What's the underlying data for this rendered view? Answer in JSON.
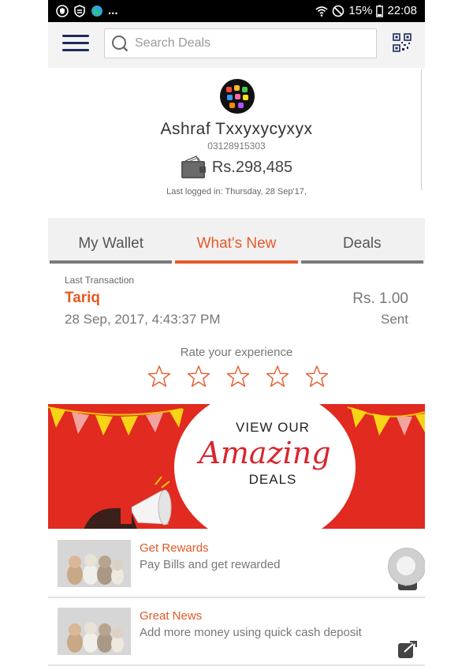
{
  "status_bar": {
    "left_extra": "...",
    "battery_pct": "15%",
    "time": "22:08"
  },
  "search": {
    "placeholder": "Search Deals"
  },
  "profile": {
    "name": "Ashraf Txxyxycyxyx",
    "phone": "03128915303",
    "balance": "Rs.298,485",
    "last_logged": "Last logged in: Thursday, 28 Sep'17,"
  },
  "tabs": [
    {
      "label": "My Wallet"
    },
    {
      "label": "What's New"
    },
    {
      "label": "Deals"
    }
  ],
  "transaction": {
    "label": "Last Transaction",
    "name": "Tariq",
    "amount": "Rs. 1.00",
    "date": "28 Sep, 2017, 4:43:37 PM",
    "status": "Sent"
  },
  "rating": {
    "label": "Rate your experience",
    "max_stars": 5,
    "value": 0
  },
  "banner": {
    "line1": "VIEW OUR",
    "line2": "Amazing",
    "line3": "DEALS"
  },
  "list": [
    {
      "title": "Get Rewards",
      "desc": "Pay Bills and get rewarded",
      "icon": "play-icon"
    },
    {
      "title": "Great News",
      "desc": "Add more money using quick cash deposit",
      "icon": "external-link-icon"
    }
  ],
  "colors": {
    "accent": "#e75a2b",
    "nav": "#1f2a5c",
    "banner_red": "#e12a20"
  }
}
